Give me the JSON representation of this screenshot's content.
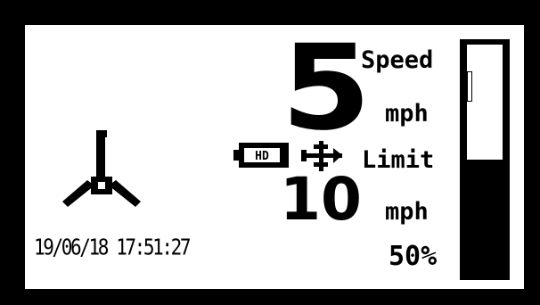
{
  "display": {
    "speed_value": "5",
    "speed_label": "Speed",
    "speed_unit": "mph",
    "limit_label": "Limit",
    "limit_value": "10",
    "limit_unit": "mph",
    "power_percent_label": "50%",
    "power_level_fraction": 0.5,
    "datetime": "19/06/18 17:51:27",
    "battery_label": "HD"
  },
  "icons": {
    "mower": "blade-icon",
    "battery": "battery-icon",
    "connection": "usb-icon"
  },
  "colors": {
    "background": "#ffffff",
    "foreground": "#000000"
  }
}
